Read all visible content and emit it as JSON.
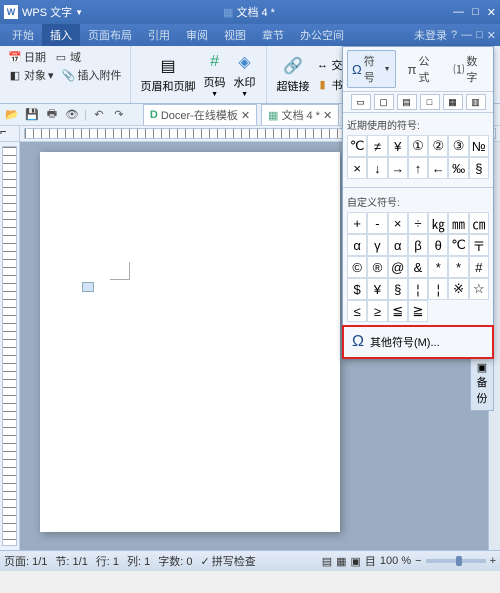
{
  "titlebar": {
    "app_name": "WPS 文字",
    "doc_title": "文档 4 *"
  },
  "menu": {
    "items": [
      "开始",
      "插入",
      "页面布局",
      "引用",
      "审阅",
      "视图",
      "章节",
      "办公空间"
    ],
    "active_index": 1,
    "login": "未登录"
  },
  "ribbon": {
    "g1": {
      "date": "日期",
      "field": "域",
      "object": "对象",
      "attach": "插入附件"
    },
    "g2": {
      "header_footer": "页眉和页脚",
      "pagenum": "页码",
      "watermark": "水印"
    },
    "g3": {
      "hyperlink": "超链接",
      "crossref": "交叉引用",
      "bookmark": "书签"
    },
    "g4": {
      "symbol": "符号",
      "pi": "公式",
      "number": "数字"
    }
  },
  "tabs": {
    "docer": "Docer-在线模板",
    "doc": "文档 4 *"
  },
  "symbol_panel": {
    "tab_symbol": "符号",
    "tab_pi": "公式",
    "tab_num": "数字",
    "recent_title": "近期使用的符号:",
    "recent": [
      "℃",
      "≠",
      "¥",
      "①",
      "②",
      "③",
      "№",
      "×",
      "↓",
      "→",
      "↑",
      "←",
      "‰",
      "§"
    ],
    "custom_title": "自定义符号:",
    "custom": [
      "+",
      "-",
      "×",
      "÷",
      "㎏",
      "㎜",
      "㎝",
      "α",
      "γ",
      "α",
      "β",
      "θ",
      "℃",
      "〒",
      "©",
      "®",
      "@",
      "&",
      "*",
      "*",
      "#",
      "$",
      "¥",
      "§",
      "¦",
      "¦",
      "※",
      "☆",
      "≤",
      "≥",
      "≦",
      "≧"
    ],
    "other": "其他符号(M)..."
  },
  "sidebar": {
    "backup": "备份"
  },
  "statusbar": {
    "page": "页面: 1/1",
    "section": "节: 1/1",
    "line": "行: 1",
    "col": "列: 1",
    "chars": "字数: 0",
    "spell": "拼写检查",
    "zoom": "100 %"
  }
}
